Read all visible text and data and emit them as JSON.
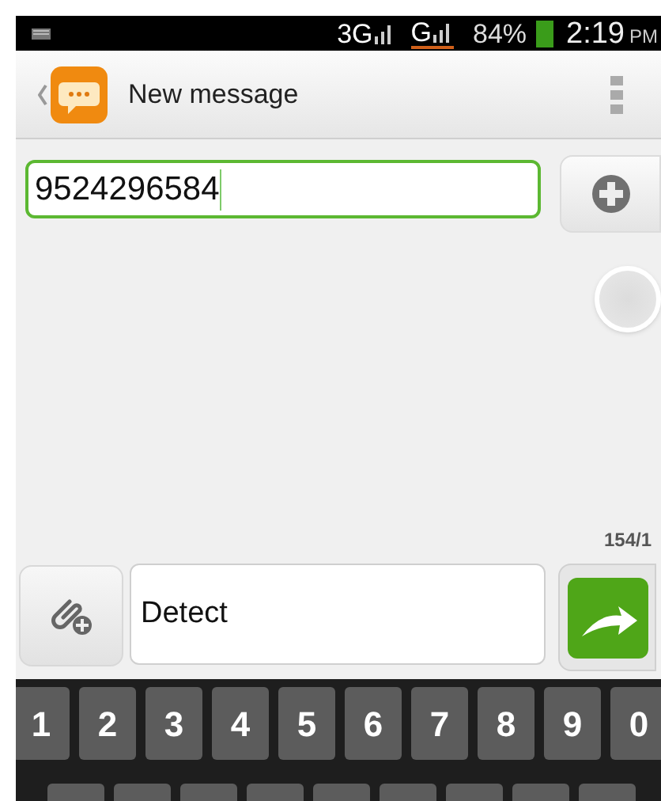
{
  "status_bar": {
    "network": "3G",
    "network_2": "G",
    "battery": "84%",
    "time": "2:19",
    "ampm": "PM"
  },
  "header": {
    "title": "New message"
  },
  "recipient": {
    "value": "9524296584",
    "focused": true
  },
  "counter": "154/1",
  "compose": {
    "value": "Detect"
  },
  "keyboard": {
    "number_keys": [
      "1",
      "2",
      "3",
      "4",
      "5",
      "6",
      "7",
      "8",
      "9",
      "0"
    ]
  }
}
